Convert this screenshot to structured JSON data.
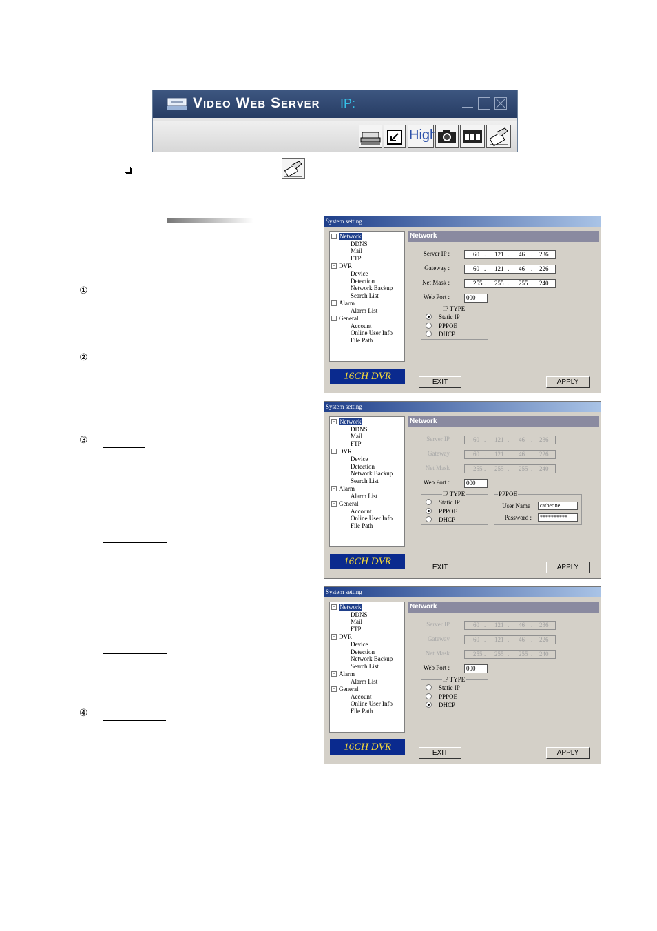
{
  "vws": {
    "title": "Video Web Server",
    "ip_label": "IP:",
    "high_label": "High"
  },
  "markers": [
    "①",
    "②",
    "③",
    "④"
  ],
  "windows": [
    {
      "caption": "System setting",
      "tree": {
        "network": "Network",
        "ddns": "DDNS",
        "mail": "Mail",
        "ftp": "FTP",
        "dvr": "DVR",
        "device": "Device",
        "detection": "Detection",
        "network_backup": "Network Backup",
        "search_list": "Search List",
        "alarm": "Alarm",
        "alarm_list": "Alarm List",
        "general": "General",
        "account": "Account",
        "online_user_info": "Online User Info",
        "file_path": "File Path"
      },
      "logo": "16CH DVR",
      "panel_title": "Network",
      "server_ip_label": "Server IP :",
      "server_ip": [
        "60",
        "121",
        "46",
        "236"
      ],
      "gateway_label": "Gateway :",
      "gateway": [
        "60",
        "121",
        "46",
        "226"
      ],
      "netmask_label": "Net Mask :",
      "netmask": [
        "255",
        "255",
        "255",
        "240"
      ],
      "webport_label": "Web Port :",
      "webport": "000",
      "iptype_title": "IP TYPE",
      "opt_static": "Static IP",
      "opt_pppoe": "PPPOE",
      "opt_dhcp": "DHCP",
      "exit_label": "EXIT",
      "apply_label": "APPLY"
    },
    {
      "caption": "System setting",
      "tree": {
        "network": "Network",
        "ddns": "DDNS",
        "mail": "Mail",
        "ftp": "FTP",
        "dvr": "DVR",
        "device": "Device",
        "detection": "Detection",
        "network_backup": "Network Backup",
        "search_list": "Search List",
        "alarm": "Alarm",
        "alarm_list": "Alarm List",
        "general": "General",
        "account": "Account",
        "online_user_info": "Online User Info",
        "file_path": "File Path"
      },
      "logo": "16CH DVR",
      "panel_title": "Network",
      "server_ip_label": "Server IP",
      "server_ip": [
        "60",
        "121",
        "46",
        "236"
      ],
      "gateway_label": "Gateway",
      "gateway": [
        "60",
        "121",
        "46",
        "226"
      ],
      "netmask_label": "Net Mask",
      "netmask": [
        "255",
        "255",
        "255",
        "240"
      ],
      "webport_label": "Web Port :",
      "webport": "000",
      "iptype_title": "IP TYPE",
      "opt_static": "Static IP",
      "opt_pppoe": "PPPOE",
      "opt_dhcp": "DHCP",
      "pppoe_title": "PPPOE",
      "username_label": "User Name",
      "username": "catherine",
      "password_label": "Password :",
      "password": "**********",
      "exit_label": "EXIT",
      "apply_label": "APPLY"
    },
    {
      "caption": "System setting",
      "tree": {
        "network": "Network",
        "ddns": "DDNS",
        "mail": "Mail",
        "ftp": "FTP",
        "dvr": "DVR",
        "device": "Device",
        "detection": "Detection",
        "network_backup": "Network Backup",
        "search_list": "Search List",
        "alarm": "Alarm",
        "alarm_list": "Alarm List",
        "general": "General",
        "account": "Account",
        "online_user_info": "Online User Info",
        "file_path": "File Path"
      },
      "logo": "16CH DVR",
      "panel_title": "Network",
      "server_ip_label": "Server IP",
      "server_ip": [
        "60",
        "121",
        "46",
        "236"
      ],
      "gateway_label": "Gateway",
      "gateway": [
        "60",
        "121",
        "46",
        "226"
      ],
      "netmask_label": "Net Mask",
      "netmask": [
        "255",
        "255",
        "255",
        "240"
      ],
      "webport_label": "Web Port :",
      "webport": "000",
      "iptype_title": "IP TYPE",
      "opt_static": "Static IP",
      "opt_pppoe": "PPPOE",
      "opt_dhcp": "DHCP",
      "exit_label": "EXIT",
      "apply_label": "APPLY"
    }
  ]
}
